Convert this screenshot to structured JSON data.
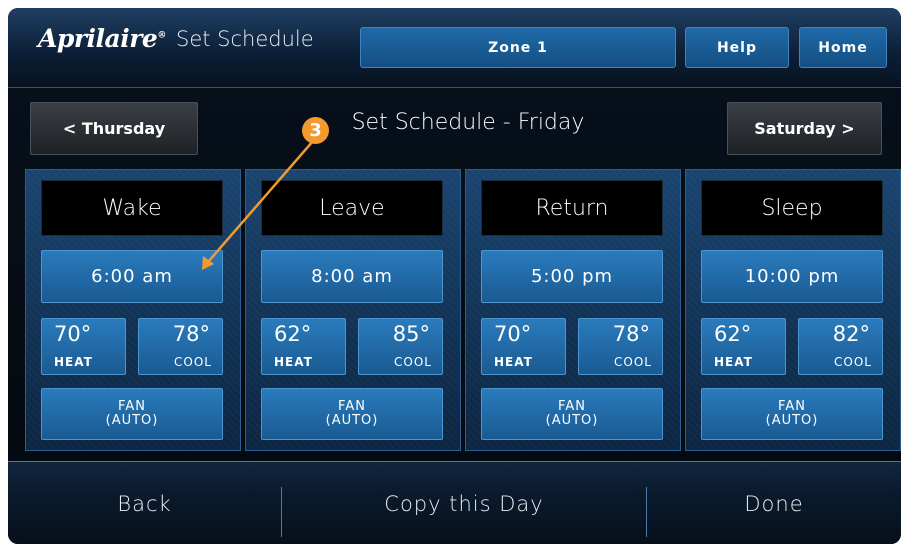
{
  "header": {
    "brand": "Aprilaire",
    "brand_mark": "®",
    "title": "Set Schedule",
    "zone": "Zone 1",
    "help": "Help",
    "home": "Home"
  },
  "day_nav": {
    "prev": "< Thursday",
    "title": "Set Schedule - Friday",
    "next": "Saturday >"
  },
  "periods": [
    {
      "name": "Wake",
      "time": "6:00 am",
      "heat": "70°",
      "heat_label": "HEAT",
      "cool": "78°",
      "cool_label": "COOL",
      "fan": "FAN",
      "fan_mode": "(AUTO)"
    },
    {
      "name": "Leave",
      "time": "8:00 am",
      "heat": "62°",
      "heat_label": "HEAT",
      "cool": "85°",
      "cool_label": "COOL",
      "fan": "FAN",
      "fan_mode": "(AUTO)"
    },
    {
      "name": "Return",
      "time": "5:00 pm",
      "heat": "70°",
      "heat_label": "HEAT",
      "cool": "78°",
      "cool_label": "COOL",
      "fan": "FAN",
      "fan_mode": "(AUTO)"
    },
    {
      "name": "Sleep",
      "time": "10:00 pm",
      "heat": "62°",
      "heat_label": "HEAT",
      "cool": "82°",
      "cool_label": "COOL",
      "fan": "FAN",
      "fan_mode": "(AUTO)"
    }
  ],
  "footer": {
    "back": "Back",
    "copy": "Copy this Day",
    "done": "Done"
  },
  "callout": {
    "number": "3",
    "color": "#f29a2e"
  },
  "colors": {
    "button_blue": "#1f6aa8",
    "background": "#04090f"
  }
}
